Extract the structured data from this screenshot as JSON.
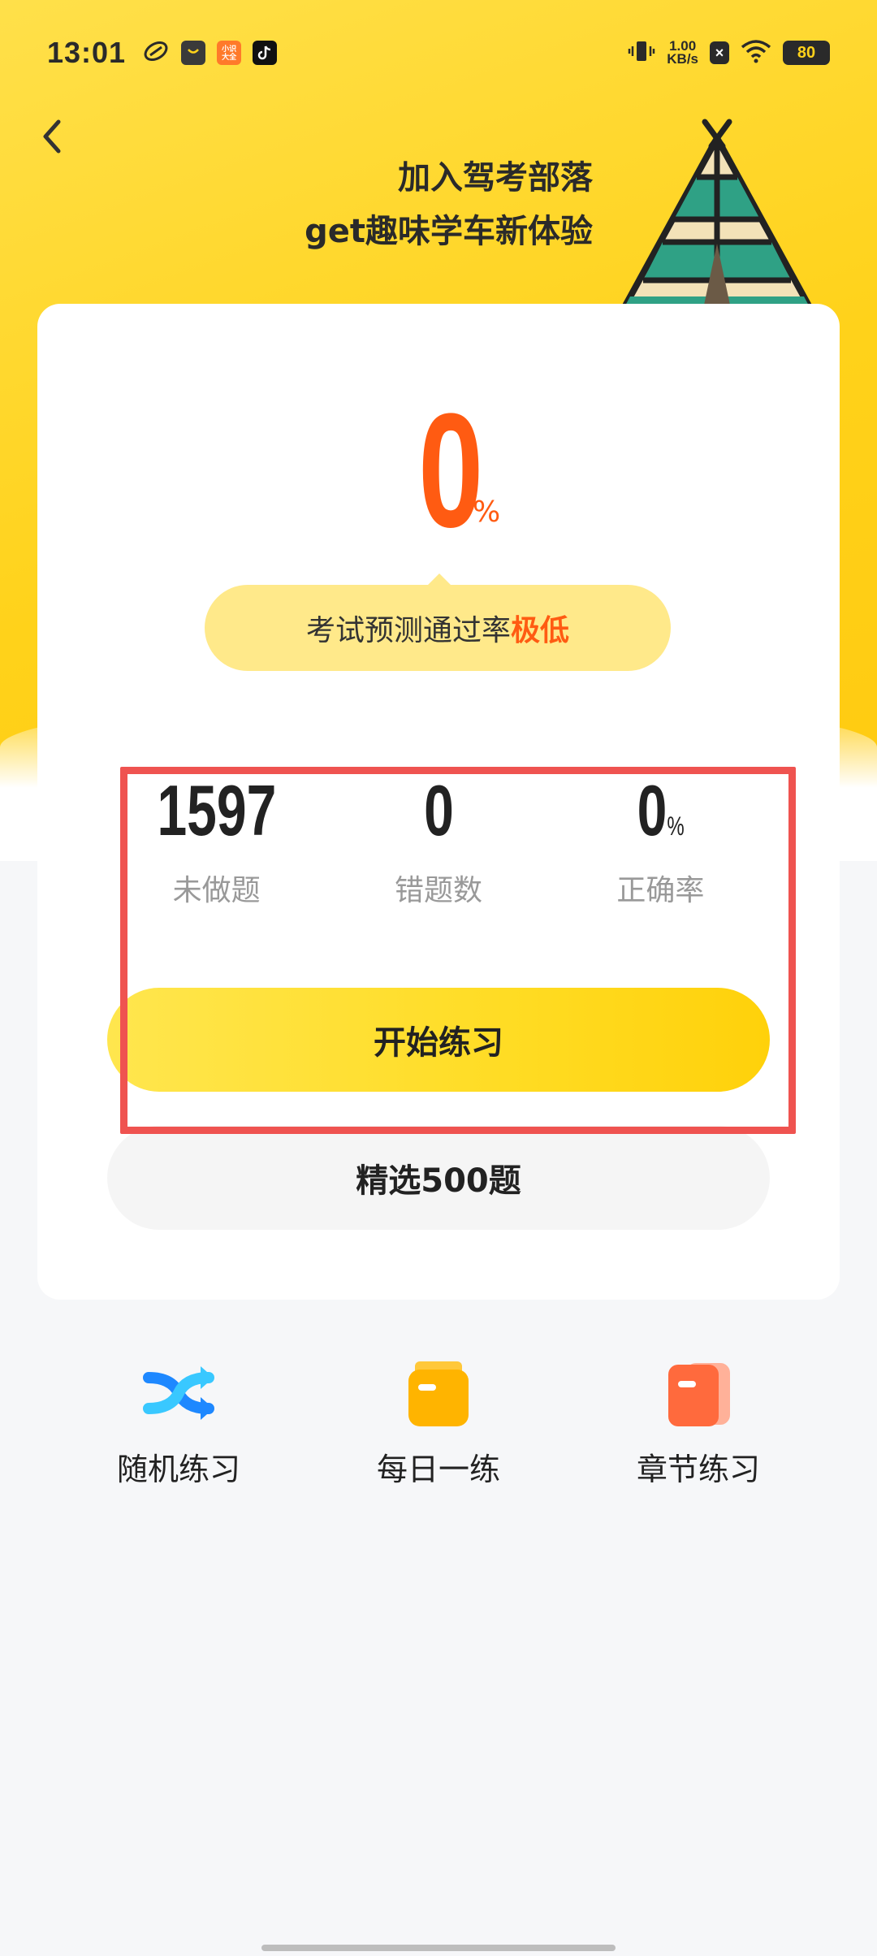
{
  "status_bar": {
    "time": "13:01",
    "net_speed_value": "1.00",
    "net_speed_unit": "KB/s",
    "battery": "80",
    "app_icon_xiaozhi_label": "小识\n大全"
  },
  "header": {
    "slogan_line1": "加入驾考部落",
    "slogan_line2": "get趣味学车新体验"
  },
  "prediction": {
    "rate": "0",
    "unit": "%",
    "text": "考试预测通过率",
    "level": "极低"
  },
  "stats": [
    {
      "value": "1597",
      "unit": "",
      "label": "未做题"
    },
    {
      "value": "0",
      "unit": "",
      "label": "错题数"
    },
    {
      "value": "0",
      "unit": "%",
      "label": "正确率"
    }
  ],
  "buttons": {
    "start_practice": "开始练习",
    "selected_500": "精选500题"
  },
  "quick_actions": [
    {
      "label": "随机练习",
      "icon": "shuffle-icon"
    },
    {
      "label": "每日一练",
      "icon": "daily-folder-icon"
    },
    {
      "label": "章节练习",
      "icon": "chapter-book-icon"
    }
  ],
  "colors": {
    "brand_yellow": "#ffd21a",
    "accent_orange": "#ff5b12",
    "highlight_red": "#ef5350"
  }
}
